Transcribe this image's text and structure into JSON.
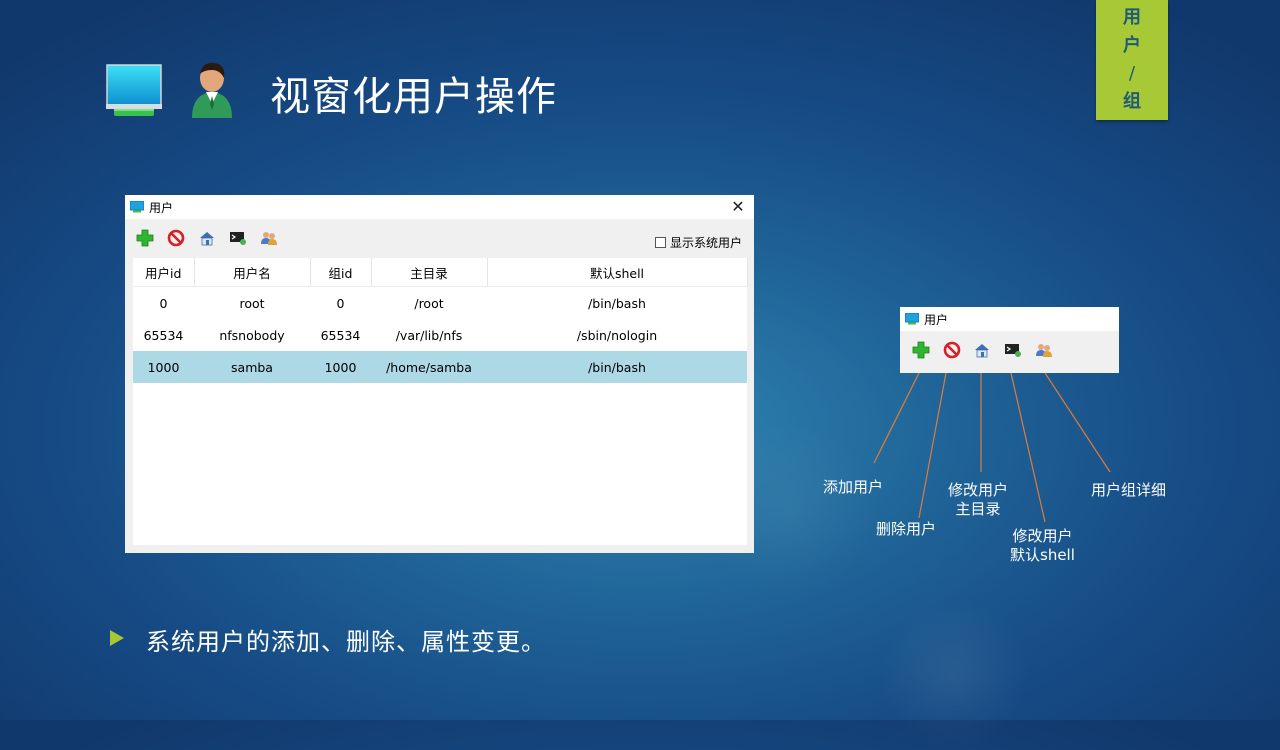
{
  "slide": {
    "title": "视窗化用户操作",
    "corner_tag": [
      "用",
      "户",
      "/",
      "组"
    ],
    "bullet": "系统用户的添加、删除、属性变更。",
    "accent_color": "#a6c935"
  },
  "main_window": {
    "title": "用户",
    "close_glyph": "✕",
    "show_system_users_label": "显示系统用户",
    "show_system_users_checked": false,
    "toolbar_icons": [
      "add-user-icon",
      "delete-user-icon",
      "home-dir-icon",
      "shell-icon",
      "group-detail-icon"
    ],
    "columns": [
      "用户id",
      "用户名",
      "组id",
      "主目录",
      "默认shell"
    ],
    "rows": [
      [
        "0",
        "root",
        "0",
        "/root",
        "/bin/bash"
      ],
      [
        "65534",
        "nfsnobody",
        "65534",
        "/var/lib/nfs",
        "/sbin/nologin"
      ],
      [
        "1000",
        "samba",
        "1000",
        "/home/samba",
        "/bin/bash"
      ]
    ],
    "selected_row": 3
  },
  "mini_window": {
    "title": "用户"
  },
  "annotations": {
    "add_user": "添加用户",
    "delete_user": "删除用户",
    "modify_home_line1": "修改用户",
    "modify_home_line2": "主目录",
    "modify_shell_line1": "修改用户",
    "modify_shell_line2": "默认shell",
    "group_detail": "用户组详细"
  },
  "colors": {
    "callout_line": "#e07b39",
    "selection": "#add8e6",
    "corner_tag_text": "#1f5b78"
  }
}
